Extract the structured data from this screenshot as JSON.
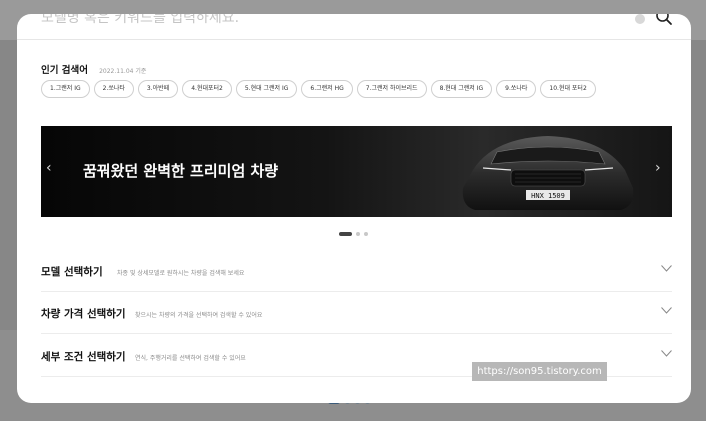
{
  "search": {
    "placeholder": "모델명 혹은 키워드를 입력하세요."
  },
  "popular": {
    "title": "인기 검색어",
    "date": "2022.11.04 기준",
    "chips": [
      "1.그랜저 IG",
      "2.쏘나타",
      "3.아반떼",
      "4.현대포터2",
      "5.현대 그랜저 IG",
      "6.그랜저 HG",
      "7.그랜저 하이브리드",
      "8.현대 그랜저 IG",
      "9.쏘나타",
      "10.현대 포터2"
    ]
  },
  "banner": {
    "headline": "꿈꿔왔던 완벽한 프리미엄 차량",
    "plate": "HNX 1509",
    "slide_count": 3,
    "active_slide": 1
  },
  "sections": [
    {
      "title": "모델 선택하기",
      "desc": "차종 및 상세모델로 원하시는 차량을 검색해 보세요"
    },
    {
      "title": "차량 가격 선택하기",
      "desc": "찾으시는 차량의 가격을 선택하여 검색할 수 있어요"
    },
    {
      "title": "세부 조건 선택하기",
      "desc": "연식, 주행거리를 선택하여 검색할 수 있어요"
    }
  ],
  "watermark": "https://son95.tistory.com"
}
